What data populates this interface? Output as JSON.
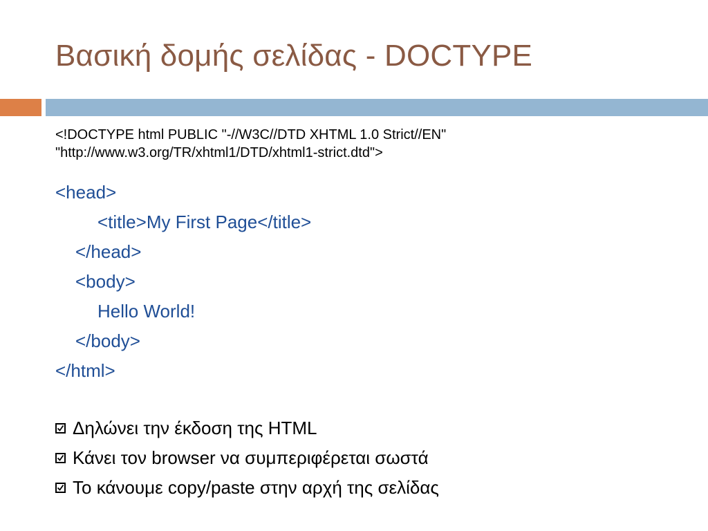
{
  "slide": {
    "title": "Βασική δομής σελίδας - DOCTYPE",
    "doctype_lines": [
      "<!DOCTYPE html PUBLIC \"-//W3C//DTD XHTML 1.0 Strict//EN\"",
      "\"http://www.w3.org/TR/xhtml1/DTD/xhtml1-strict.dtd\">"
    ],
    "code_lines": [
      "<head>",
      "<title>My First Page</title>",
      "</head>",
      "<body>",
      "Hello World!",
      "</body>",
      "</html>"
    ],
    "bullets": [
      "Δηλώνει την έκδοση της HTML",
      "Κάνει τον browser να συμπεριφέρεται σωστά",
      "Το κάνουμε copy/paste στην αρχή της σελίδας"
    ],
    "bullet_icon": "checked-box-icon",
    "colors": {
      "title": "#8a5a44",
      "accent_orange": "#dd8047",
      "accent_blue": "#94b6d2",
      "code": "#1f4e96"
    }
  }
}
